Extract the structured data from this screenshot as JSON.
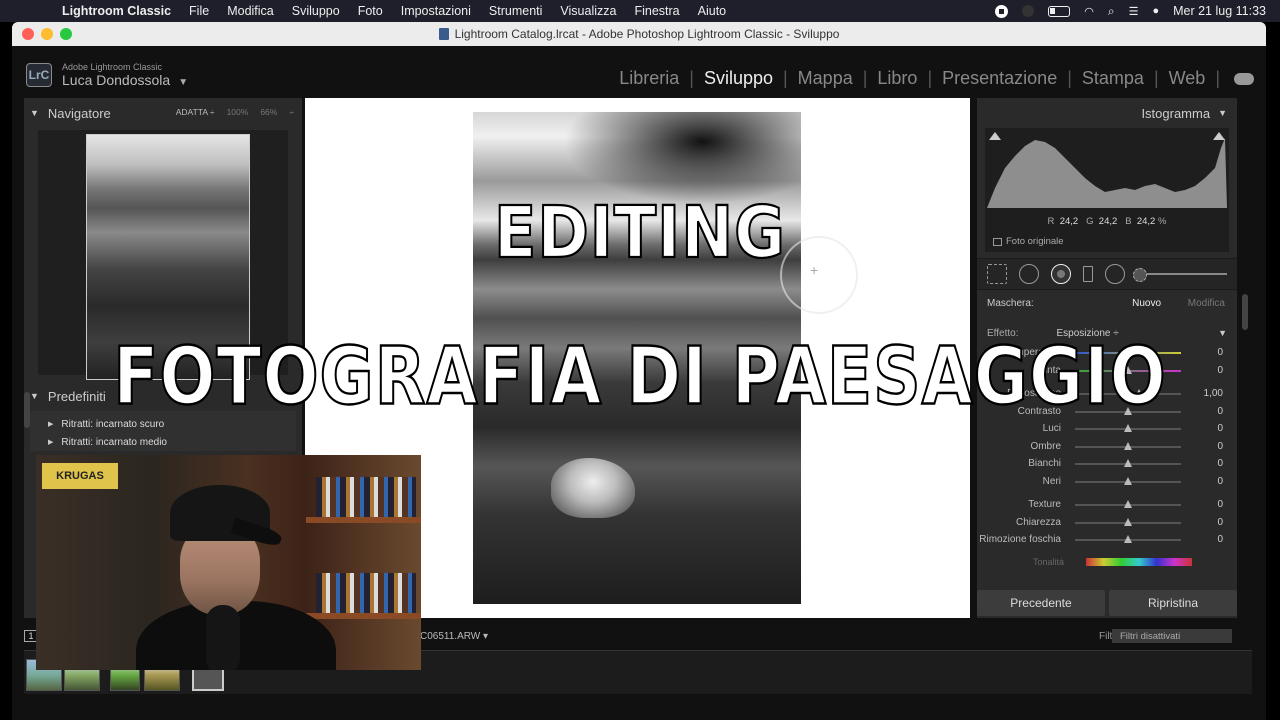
{
  "menubar": {
    "app_name": "Lightroom Classic",
    "items": [
      "File",
      "Modifica",
      "Sviluppo",
      "Foto",
      "Impostazioni",
      "Strumenti",
      "Visualizza",
      "Finestra",
      "Aiuto"
    ],
    "datetime": "Mer 21 lug  11:33"
  },
  "window": {
    "title": "Lightroom Catalog.lrcat - Adobe Photoshop Lightroom Classic - Sviluppo"
  },
  "identity": {
    "badge": "LrC",
    "product": "Adobe Lightroom Classic",
    "user": "Luca Dondossola",
    "caret": "▼"
  },
  "modules": [
    "Libreria",
    "Sviluppo",
    "Mappa",
    "Libro",
    "Presentazione",
    "Stampa",
    "Web"
  ],
  "active_module": "Sviluppo",
  "navigator": {
    "title": "Navigatore",
    "opt_fit": "ADATTA ÷",
    "opt_100": "100%",
    "opt_66": "66%",
    "opt_more": "÷"
  },
  "presets": {
    "title": "Predefiniti",
    "items": [
      "Ritratti: incarnato scuro",
      "Ritratti: incarnato medio"
    ]
  },
  "overlay": {
    "line1": "EDITING",
    "line2": "FOTOGRAFIA DI PAESAGGIO"
  },
  "histogram": {
    "title": "Istogramma",
    "r_label": "R",
    "r_value": "24,2",
    "g_label": "G",
    "g_value": "24,2",
    "b_label": "B",
    "b_value": "24,2",
    "unit": "%",
    "original_photo": "Foto originale"
  },
  "mask": {
    "label": "Maschera:",
    "new": "Nuovo",
    "edit": "Modifica"
  },
  "effect": {
    "label": "Effetto:",
    "value": "Esposizione  ÷"
  },
  "sliders_group1": [
    {
      "label": "Temperatura",
      "value": "0",
      "level": 0.5
    },
    {
      "label": "Tinta",
      "value": "0",
      "level": 0.5
    }
  ],
  "sliders_group2": [
    {
      "label": "Esposizione",
      "value": "1,00",
      "level": 0.6
    },
    {
      "label": "Contrasto",
      "value": "0",
      "level": 0.5
    },
    {
      "label": "Luci",
      "value": "0",
      "level": 0.5
    },
    {
      "label": "Ombre",
      "value": "0",
      "level": 0.5
    },
    {
      "label": "Bianchi",
      "value": "0",
      "level": 0.5
    },
    {
      "label": "Neri",
      "value": "0",
      "level": 0.5
    }
  ],
  "sliders_group3": [
    {
      "label": "Texture",
      "value": "0",
      "level": 0.5
    },
    {
      "label": "Chiarezza",
      "value": "0",
      "level": 0.5
    },
    {
      "label": "Rimozione foschia",
      "value": "0",
      "level": 0.5
    }
  ],
  "tonality_label": "Tonalità",
  "buttons": {
    "previous": "Precedente",
    "reset": "Ripristina"
  },
  "filmstrip": {
    "page": "1",
    "filename": "C06511.ARW ▾",
    "filter_label": "Filtro:",
    "filter_value": "Filtri disattivati"
  },
  "webcam": {
    "poster_text": "KRUGAS"
  }
}
